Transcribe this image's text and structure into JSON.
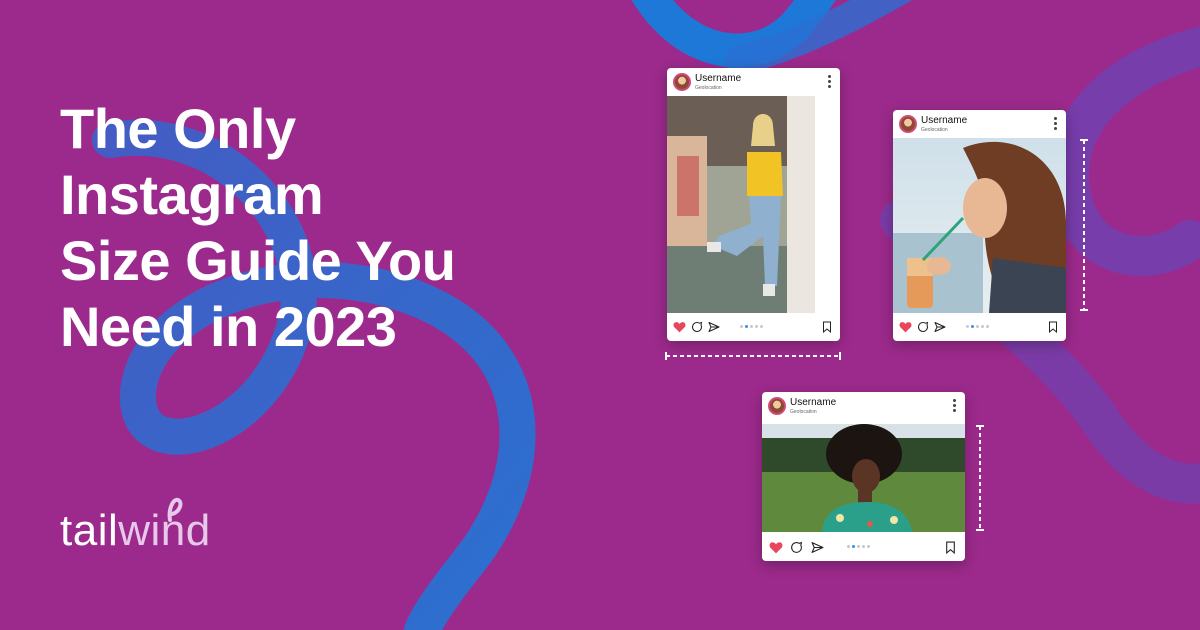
{
  "headline": {
    "lines": [
      "The Only",
      "Instagram",
      "Size Guide You",
      "Need in 2023"
    ]
  },
  "brand": {
    "tail": "tail",
    "wind": "wind"
  },
  "colors": {
    "background": "#9C2A8C",
    "swirl": "#2D6FD1",
    "heart": "#E8465E",
    "active_dot": "#3D8EE6"
  },
  "cards": [
    {
      "username": "Username",
      "geolocation": "Geolocation",
      "format": "portrait"
    },
    {
      "username": "Username",
      "geolocation": "Geolocation",
      "format": "square"
    },
    {
      "username": "Username",
      "geolocation": "Geolocation",
      "format": "landscape"
    }
  ],
  "icons": {
    "like": "heart-icon",
    "comment": "comment-icon",
    "share": "send-icon",
    "save": "bookmark-icon",
    "menu": "kebab-menu-icon"
  }
}
